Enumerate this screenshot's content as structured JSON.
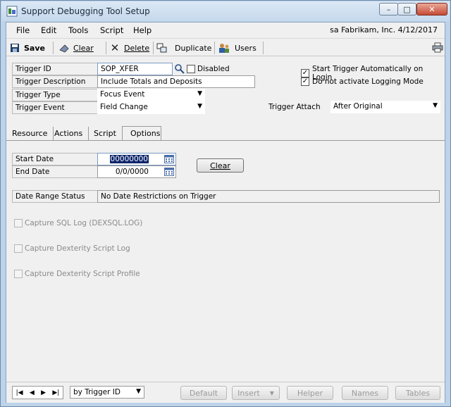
{
  "window": {
    "title": "Support Debugging Tool Setup",
    "controls": {
      "minimize": "–",
      "maximize": "□",
      "close": "✕"
    }
  },
  "menubar": {
    "items": [
      "File",
      "Edit",
      "Tools",
      "Script",
      "Help"
    ],
    "info": "sa  Fabrikam, Inc.  4/12/2017"
  },
  "toolbar": {
    "save": "Save",
    "clear": "Clear",
    "delete": "Delete",
    "duplicate": "Duplicate",
    "users": "Users"
  },
  "form": {
    "trigger_id": {
      "label": "Trigger ID",
      "value": "SOP_XFER"
    },
    "disabled": {
      "label": "Disabled",
      "checked": false
    },
    "trigger_description": {
      "label": "Trigger Description",
      "value": "Include Totals and Deposits"
    },
    "trigger_type": {
      "label": "Trigger Type",
      "value": "Focus Event"
    },
    "trigger_event": {
      "label": "Trigger Event",
      "value": "Field Change"
    },
    "start_auto": {
      "label": "Start Trigger Automatically on Login",
      "checked": true
    },
    "no_logging": {
      "label": "Do not activate Logging Mode",
      "checked": true
    },
    "trigger_attach": {
      "label": "Trigger Attach",
      "value": "After Original"
    }
  },
  "tabs": [
    "Resource",
    "Actions",
    "Script",
    "Options"
  ],
  "active_tab": "Options",
  "options": {
    "start_date": {
      "label": "Start Date",
      "value": "00000000"
    },
    "end_date": {
      "label": "End Date",
      "value": "0/0/0000"
    },
    "clear_button": "Clear",
    "date_range_status": {
      "label": "Date Range Status",
      "value": "No Date Restrictions on Trigger"
    },
    "capture_sql": "Capture SQL Log (DEXSQL.LOG)",
    "capture_dex_log": "Capture Dexterity Script Log",
    "capture_dex_profile": "Capture Dexterity Script Profile"
  },
  "bottom": {
    "sort_by": "by Trigger ID",
    "default": "Default",
    "insert": "Insert",
    "helper": "Helper",
    "names": "Names",
    "tables": "Tables"
  }
}
